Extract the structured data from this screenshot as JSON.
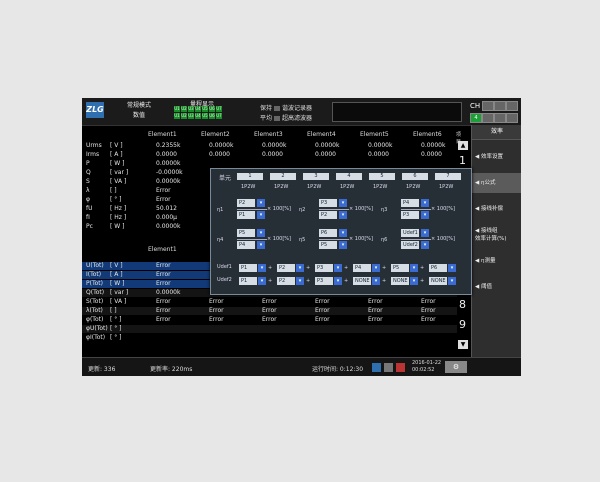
{
  "topbar": {
    "mode_line1": "常规模式",
    "mode_line2": "数值",
    "update_label": "量程显示",
    "channels_row1": [
      "U1",
      "U2",
      "U3",
      "U4",
      "U5",
      "U6",
      "U7"
    ],
    "channels_row2": [
      "U1",
      "U2",
      "U3",
      "U4",
      "U5",
      "U6",
      "U7"
    ],
    "sw_row1": [
      "保持",
      "谐波记录器"
    ],
    "sw_row2": [
      "平均",
      "超高滤波器"
    ],
    "ch_label": "CH",
    "indicator": "4"
  },
  "table": {
    "headers": [
      "Element1",
      "Element2",
      "Element3",
      "Element4",
      "Element5",
      "Element6"
    ],
    "right_label": "项目",
    "rows": [
      {
        "name": "Urms",
        "unit": "[ V ]",
        "values": [
          "0.2355k",
          "0.0000k",
          "0.0000k",
          "0.0000k",
          "0.0000k",
          "0.0000k"
        ]
      },
      {
        "name": "Irms",
        "unit": "[ A ]",
        "values": [
          "0.0000",
          "0.0000",
          "0.0000",
          "0.0000",
          "0.0000",
          "0.0000"
        ]
      },
      {
        "name": "P",
        "unit": "[ W ]",
        "values": [
          "0.0000k",
          "",
          "",
          "",
          "",
          ""
        ]
      },
      {
        "name": "Q",
        "unit": "[ var ]",
        "values": [
          "-0.0000k",
          "",
          "",
          "",
          "",
          ""
        ]
      },
      {
        "name": "S",
        "unit": "[ VA ]",
        "values": [
          "0.0000k",
          "",
          "",
          "",
          "",
          ""
        ]
      },
      {
        "name": "λ",
        "unit": "[ ]",
        "values": [
          "Error",
          "",
          "",
          "",
          "",
          ""
        ]
      },
      {
        "name": "φ",
        "unit": "[ ° ]",
        "values": [
          "Error",
          "",
          "",
          "",
          "",
          ""
        ]
      },
      {
        "name": "fU",
        "unit": "[ Hz ]",
        "values": [
          "50.012",
          "",
          "",
          "",
          "",
          ""
        ]
      },
      {
        "name": "fI",
        "unit": "[ Hz ]",
        "values": [
          "0.000μ",
          "",
          "",
          "",
          "",
          ""
        ]
      },
      {
        "name": "Pc",
        "unit": "[ W ]",
        "values": [
          "0.0000k",
          "",
          "",
          "",
          "",
          ""
        ]
      }
    ],
    "sec2_header": "Element1",
    "rows2": [
      {
        "name": "U(Tot)",
        "unit": "[ V ]",
        "values": [
          "Error",
          "",
          "",
          "",
          "",
          ""
        ]
      },
      {
        "name": "I(Tot)",
        "unit": "[ A ]",
        "values": [
          "Error",
          "",
          "",
          "",
          "",
          ""
        ]
      },
      {
        "name": "P(Tot)",
        "unit": "[ W ]",
        "values": [
          "Error",
          "",
          "",
          "",
          "",
          ""
        ]
      },
      {
        "name": "Q(Tot)",
        "unit": "[ var ]",
        "values": [
          "0.0000k",
          "",
          "",
          "",
          "",
          ""
        ]
      },
      {
        "name": "S(Tot)",
        "unit": "[ VA ]",
        "values": [
          "Error",
          "Error",
          "Error",
          "Error",
          "Error",
          "Error"
        ]
      },
      {
        "name": "λ(Tot)",
        "unit": "[ ]",
        "values": [
          "Error",
          "Error",
          "Error",
          "Error",
          "Error",
          "Error"
        ]
      },
      {
        "name": "φ(Tot)",
        "unit": "[ ° ]",
        "values": [
          "Error",
          "Error",
          "Error",
          "Error",
          "Error",
          "Error"
        ]
      },
      {
        "name": "φU(Tot)",
        "unit": "[ ° ]",
        "values": [
          "",
          "",
          "",
          "",
          "",
          ""
        ]
      },
      {
        "name": "φI(Tot)",
        "unit": "[ ° ]",
        "values": [
          "",
          "",
          "",
          "",
          "",
          ""
        ]
      }
    ],
    "page_digits": [
      "1",
      "8",
      "9"
    ]
  },
  "popup": {
    "unit_label": "单元",
    "units": [
      "1",
      "2",
      "3",
      "4",
      "5",
      "6",
      "7"
    ],
    "wiring": [
      "1P2W",
      "1P2W",
      "1P2W",
      "1P2W",
      "1P2W",
      "1P2W",
      "1P2W"
    ],
    "eta": [
      {
        "label": "η1",
        "num": "P2",
        "den": "P1"
      },
      {
        "label": "η2",
        "num": "P3",
        "den": "P2"
      },
      {
        "label": "η3",
        "num": "P4",
        "den": "P3"
      },
      {
        "label": "η4",
        "num": "P5",
        "den": "P4"
      },
      {
        "label": "η5",
        "num": "P6",
        "den": "P5"
      },
      {
        "label": "η6",
        "num": "Udef1",
        "den": "Udef2"
      }
    ],
    "pct": "× 100[%]",
    "udef1_label": "Udef1",
    "udef1": [
      "P1",
      "P2",
      "P3",
      "P4",
      "P5",
      "P6"
    ],
    "udef2_label": "Udef2",
    "udef2": [
      "P1",
      "P2",
      "P3",
      "NONE",
      "NONE",
      "NONE"
    ]
  },
  "rmenu": {
    "head": "效率",
    "items": [
      "效率设置",
      "η公式",
      "接线补偿",
      "接线组\n效率计算(%)",
      "η测量",
      "阈值"
    ]
  },
  "status": {
    "update": "更新: 336",
    "rate": "更新率: 220ms",
    "time_label": "运行时间: 0:12:30",
    "date": "2016-01-22",
    "clock": "00:02:52"
  }
}
